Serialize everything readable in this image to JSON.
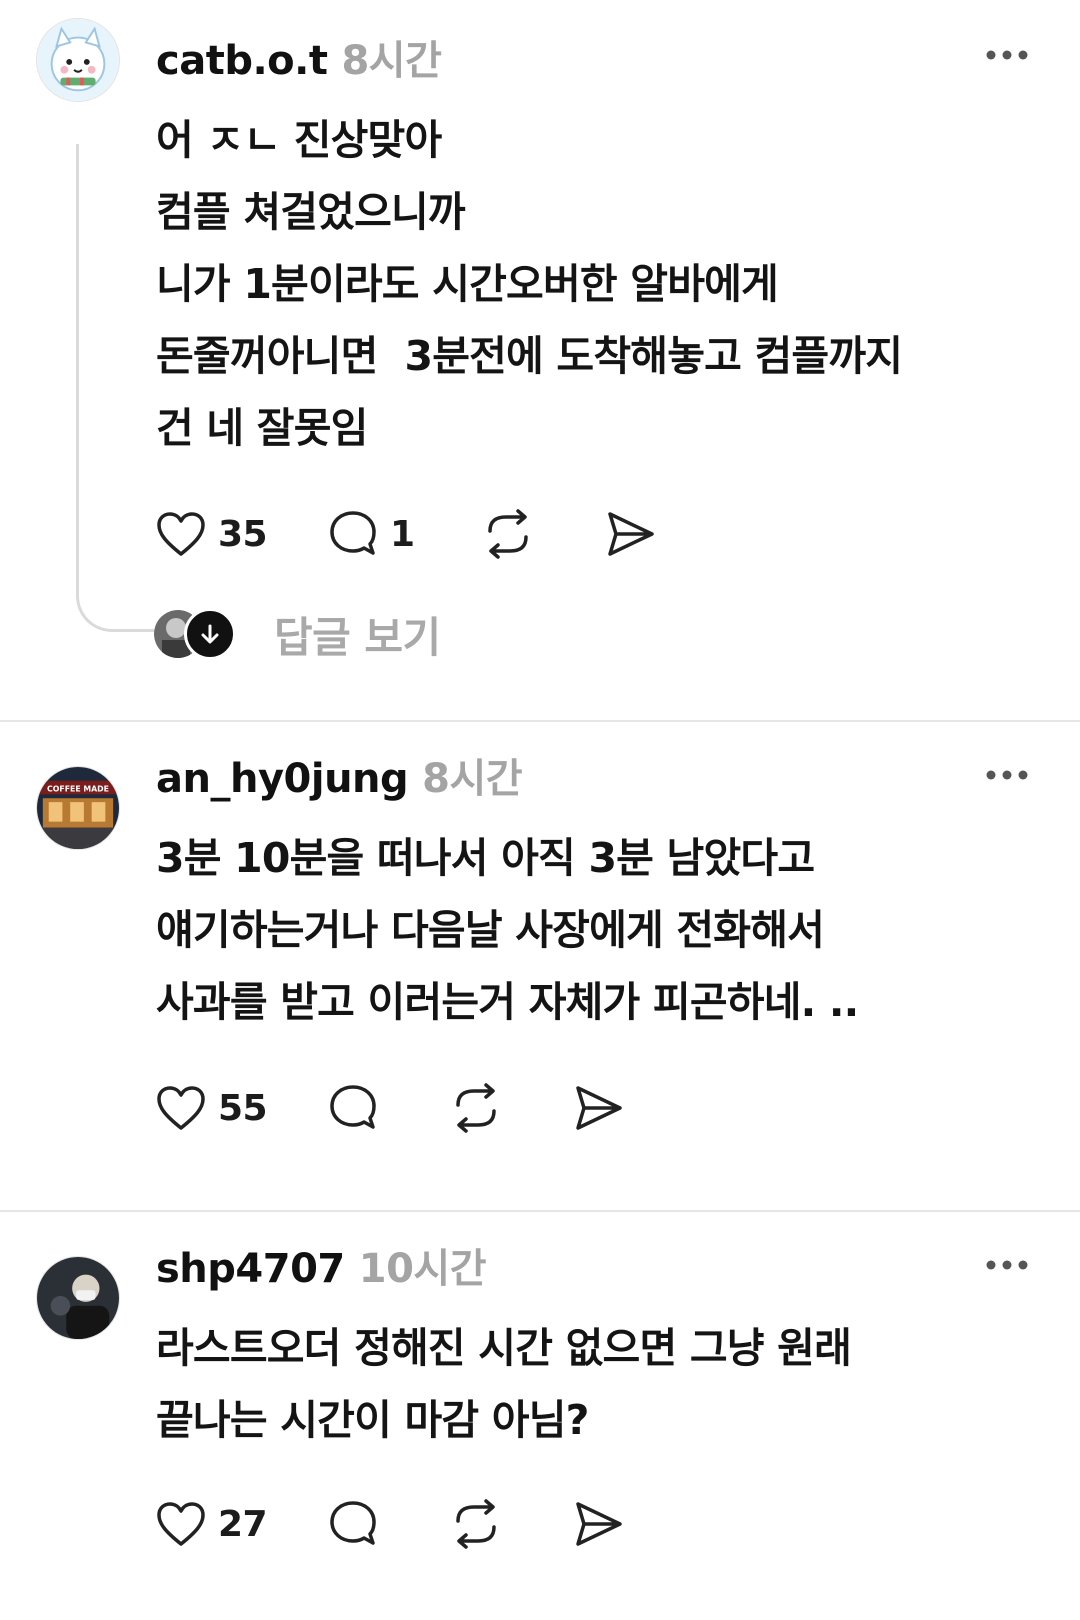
{
  "posts": [
    {
      "username": "catb.o.t",
      "time": "8시간",
      "text": "어 ㅈㄴ 진상맞아\n컴플 쳐걸었으니까\n니가 1분이라도 시간오버한 알바에게\n돈줄꺼아니면  3분전에 도착해놓고 컴플까지\n건 네 잘못임",
      "likes": "35",
      "comments": "1",
      "view_replies": "답글 보기",
      "avatar_icon": "cat-avatar-icon"
    },
    {
      "username": "an_hy0jung",
      "time": "8시간",
      "text": "3분 10분을 떠나서 아직 3분 남았다고\n얘기하는거나 다음날 사장에게 전화해서\n사과를 받고 이러는거 자체가 피곤하네. ..",
      "likes": "55",
      "comments": "",
      "avatar_text": "COFFEE MADE"
    },
    {
      "username": "shp4707",
      "time": "10시간",
      "text": "라스트오더 정해진 시간 없으면 그냥 원래\n끝나는 시간이 마감 아님?",
      "likes": "27",
      "comments": ""
    }
  ],
  "icons": {
    "like": "heart-icon",
    "comment": "comment-icon",
    "repost": "repost-icon",
    "share": "send-icon",
    "more": "more-icon"
  }
}
